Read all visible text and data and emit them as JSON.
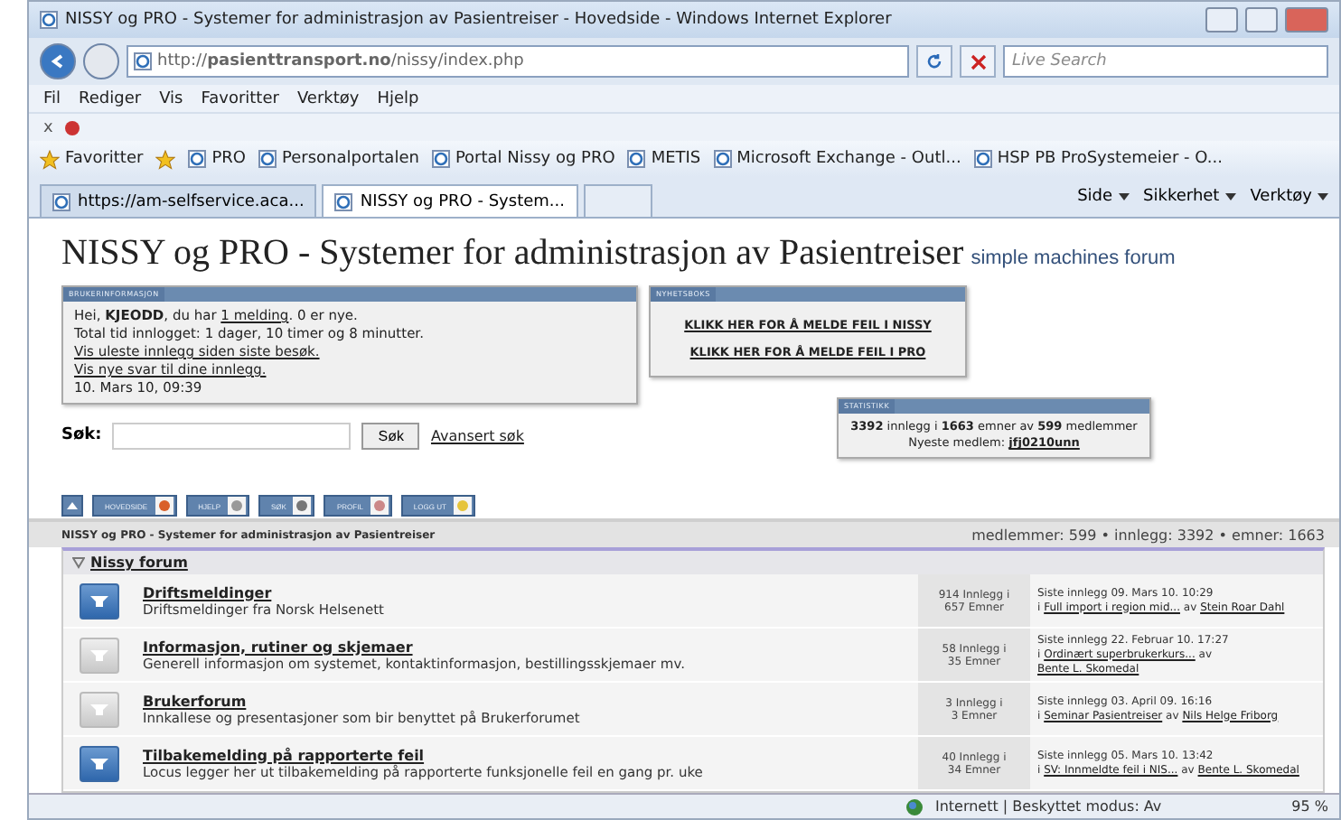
{
  "window": {
    "title": "NISSY og PRO - Systemer for administrasjon av Pasientreiser - Hovedside - Windows Internet Explorer"
  },
  "address": {
    "url": "http://**pasienttransport.no**/nissy/index.php",
    "search_placeholder": "Live Search"
  },
  "menu": [
    "Fil",
    "Rediger",
    "Vis",
    "Favoritter",
    "Verktøy",
    "Hjelp"
  ],
  "command_bar": {
    "close": "x"
  },
  "favorites": {
    "label": "Favoritter",
    "items": [
      "PRO",
      "Personalportalen",
      "Portal Nissy og PRO",
      "METIS",
      "Microsoft Exchange - Outl...",
      "HSP PB ProSystemeier - O..."
    ]
  },
  "tabs": [
    {
      "label": "https://am-selfservice.aca...",
      "selected": false
    },
    {
      "label": "NISSY og PRO - System...",
      "selected": true
    }
  ],
  "tools": [
    "Side",
    "Sikkerhet",
    "Verktøy"
  ],
  "page": {
    "title": "NISSY og PRO - Systemer for administrasjon av Pasientreiser",
    "logo": "simple machines forum",
    "user_panel": {
      "header": "BRUKERINFORMASJON",
      "greeting": {
        "before": "Hei, **KJEODD**, du har",
        "link": "1 melding",
        "after": ". 0 er nye."
      },
      "lines": [
        {
          "kind": "text",
          "text": "Total tid innlogget: 1 dager, 10 timer og 8 minutter."
        },
        {
          "kind": "link",
          "text": "Vis uleste innlegg siden siste besøk."
        },
        {
          "kind": "link",
          "text": "Vis nye svar til dine innlegg."
        },
        {
          "kind": "text",
          "text": "10. Mars 10, 09:39"
        }
      ]
    },
    "search": {
      "label": "Søk:",
      "button": "Søk",
      "advanced": "Avansert søk"
    },
    "news": {
      "header": "NYHETSBOKS",
      "links": [
        "KLIKK HER FOR Å MELDE FEIL I NISSY",
        "KLIKK HER FOR Å MELDE FEIL I PRO"
      ]
    },
    "stats": {
      "header": "STATISTIKK",
      "summary": "**3392** innlegg i **1663** emner av **599** medlemmer",
      "newest_label": "Nyeste medlem:",
      "newest": "jfj0210unn"
    },
    "nav_buttons": [
      "HOVEDSIDE",
      "HJELP",
      "SØK",
      "PROFIL",
      "LOGG UT"
    ],
    "band": {
      "title": "NISSY og PRO - Systemer for administrasjon av Pasientreiser",
      "stats": "medlemmer: 599 • innlegg: 3392 • emner: 1663"
    },
    "category": {
      "name": "Nissy forum",
      "expanded": true
    },
    "boards": [
      {
        "name": "Driftsmeldinger",
        "description": "Driftsmeldinger fra Norsk Helsenett",
        "new": true,
        "posts": "914 Innlegg i",
        "topics": "657 Emner",
        "last": "Siste innlegg 09. Mars 10. 10:29",
        "prefix": "i",
        "topic": "Full import i region mid...",
        "by": "av",
        "author": "Stein Roar Dahl"
      },
      {
        "name": "Informasjon, rutiner og skjemaer",
        "description": "Generell informasjon om systemet, kontaktinformasjon, bestillingsskjemaer mv.",
        "new": false,
        "posts": "58 Innlegg i",
        "topics": "35 Emner",
        "last": "Siste innlegg 22. Februar 10. 17:27",
        "prefix": "i",
        "topic": "Ordinært superbrukerkurs...",
        "by": "av",
        "author": "Bente L. Skomedal"
      },
      {
        "name": "Brukerforum",
        "description": "Innkallese og presentasjoner som bir benyttet på Brukerforumet",
        "new": false,
        "posts": "3 Innlegg i",
        "topics": "3 Emner",
        "last": "Siste innlegg 03. April 09. 16:16",
        "prefix": "i",
        "topic": "Seminar Pasientreiser",
        "by": "av",
        "author": "Nils Helge Friborg"
      },
      {
        "name": "Tilbakemelding på rapporterte feil",
        "description": "Locus legger her ut tilbakemelding på rapporterte funksjonelle feil en gang pr. uke",
        "new": true,
        "posts": "40 Innlegg i",
        "topics": "34 Emner",
        "last": "Siste innlegg 05. Mars 10. 13:42",
        "prefix": "i",
        "topic": "SV: Innmeldte feil i NIS...",
        "by": "av",
        "author": "Bente L. Skomedal"
      }
    ],
    "status": {
      "zone": "Internett | Beskyttet modus: Av",
      "zoom": "95 %"
    }
  }
}
